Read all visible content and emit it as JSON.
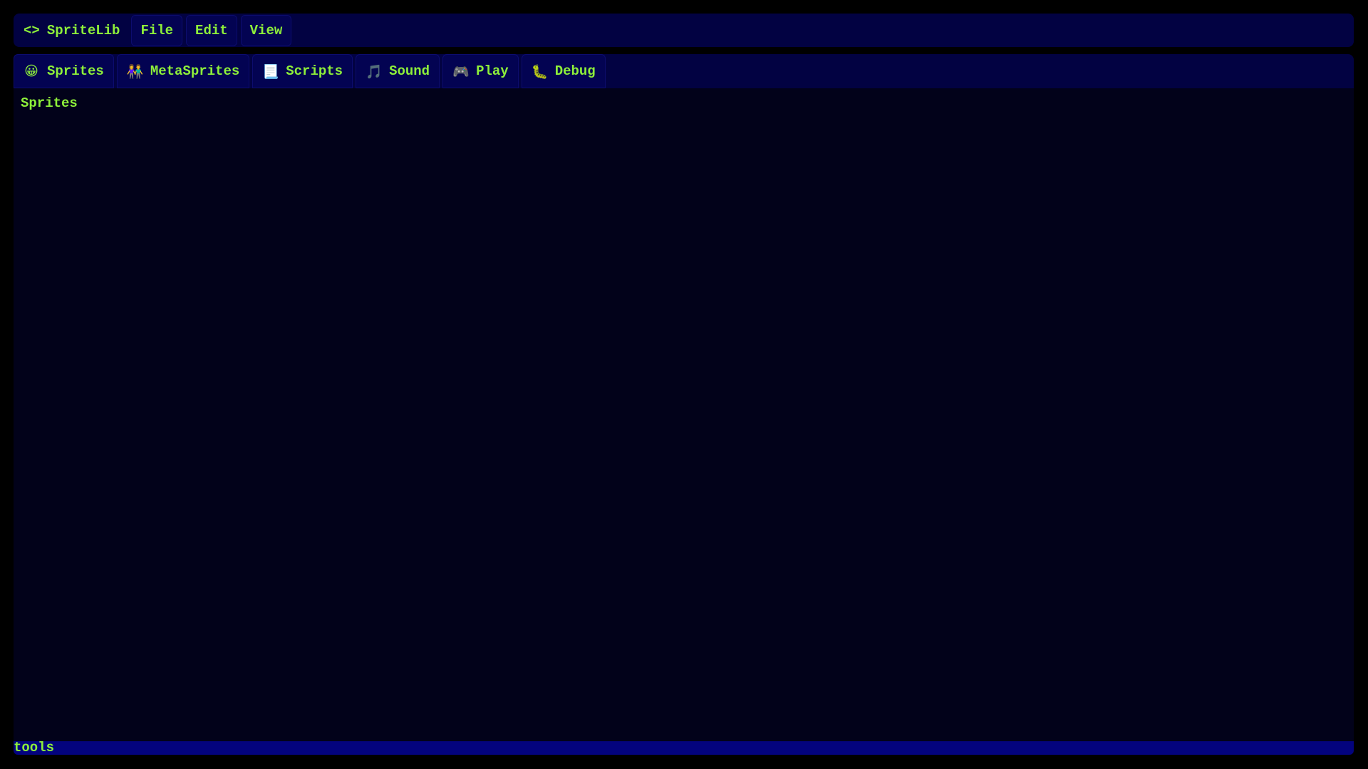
{
  "menubar": {
    "app_icon": "<>",
    "app_name": "SpriteLib",
    "items": [
      {
        "label": "File"
      },
      {
        "label": "Edit"
      },
      {
        "label": "View"
      }
    ]
  },
  "tabs": [
    {
      "icon": "😀",
      "icon_name": "smiley-face-icon",
      "label": "Sprites"
    },
    {
      "icon": "👫",
      "icon_name": "people-icon",
      "label": "MetaSprites"
    },
    {
      "icon": "📃",
      "icon_name": "document-icon",
      "label": "Scripts"
    },
    {
      "icon": "🎵",
      "icon_name": "music-note-icon",
      "label": "Sound"
    },
    {
      "icon": "🎮",
      "icon_name": "gamepad-icon",
      "label": "Play"
    },
    {
      "icon": "🐛",
      "icon_name": "bug-icon",
      "label": "Debug"
    }
  ],
  "content": {
    "heading": "Sprites"
  },
  "statusbar": {
    "text": "tools"
  },
  "colors": {
    "background": "#000000",
    "bar": "#020242",
    "button": "#030352",
    "content": "#02021a",
    "status": "#03037e",
    "text": "#8ef03a"
  }
}
